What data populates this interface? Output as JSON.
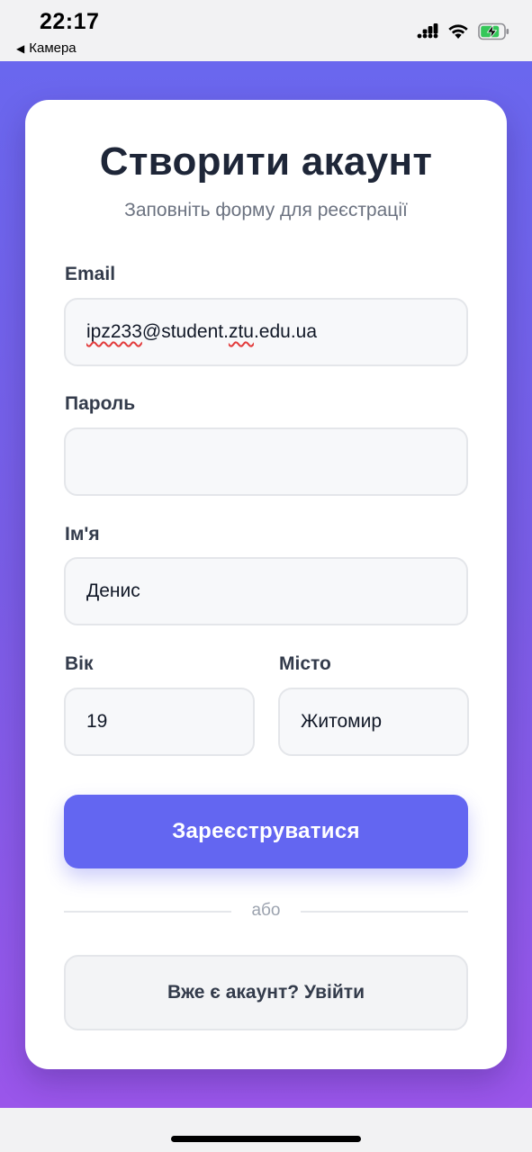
{
  "status_bar": {
    "time": "22:17",
    "back_label": "Камера"
  },
  "form": {
    "title": "Створити акаунт",
    "subtitle": "Заповніть форму для реєстрації",
    "email": {
      "label": "Email",
      "value_part1": "ipz233",
      "value_part2": "@student.",
      "value_part3": "ztu",
      "value_part4": ".edu.ua"
    },
    "password": {
      "label": "Пароль",
      "value": ""
    },
    "name": {
      "label": "Ім'я",
      "value": "Денис"
    },
    "age": {
      "label": "Вік",
      "value": "19"
    },
    "city": {
      "label": "Місто",
      "value": "Житомир"
    },
    "submit_label": "Зареєструватися",
    "divider_text": "або",
    "login_label": "Вже є акаунт? Увійти"
  },
  "colors": {
    "accent": "#6366f1",
    "gradient_top": "#6a67ee",
    "gradient_bottom": "#9a56ea"
  }
}
